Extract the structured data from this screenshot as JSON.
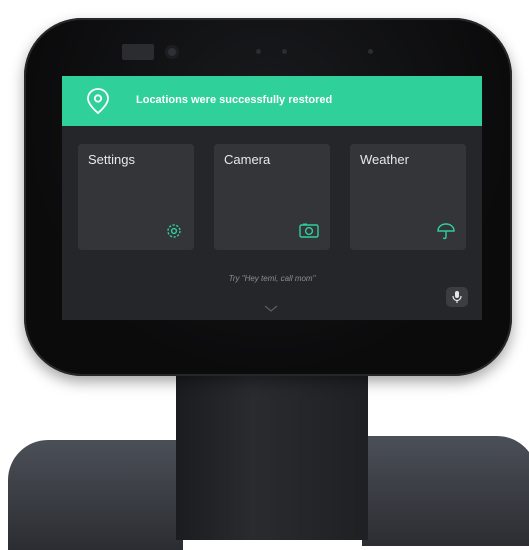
{
  "banner": {
    "message": "Locations were successfully restored",
    "icon": "location-pin-icon",
    "color": "#2fd09a"
  },
  "tiles": [
    {
      "label": "Settings",
      "icon": "gear-icon"
    },
    {
      "label": "Camera",
      "icon": "camera-icon"
    },
    {
      "label": "Weather",
      "icon": "umbrella-icon"
    }
  ],
  "hint": "Try \"Hey temi, call mom\"",
  "mic": {
    "icon": "microphone-icon"
  },
  "more": {
    "icon": "chevron-down-icon"
  },
  "colors": {
    "accent": "#2fd09a",
    "screen_bg": "#25262a",
    "tile_bg": "#333539"
  }
}
